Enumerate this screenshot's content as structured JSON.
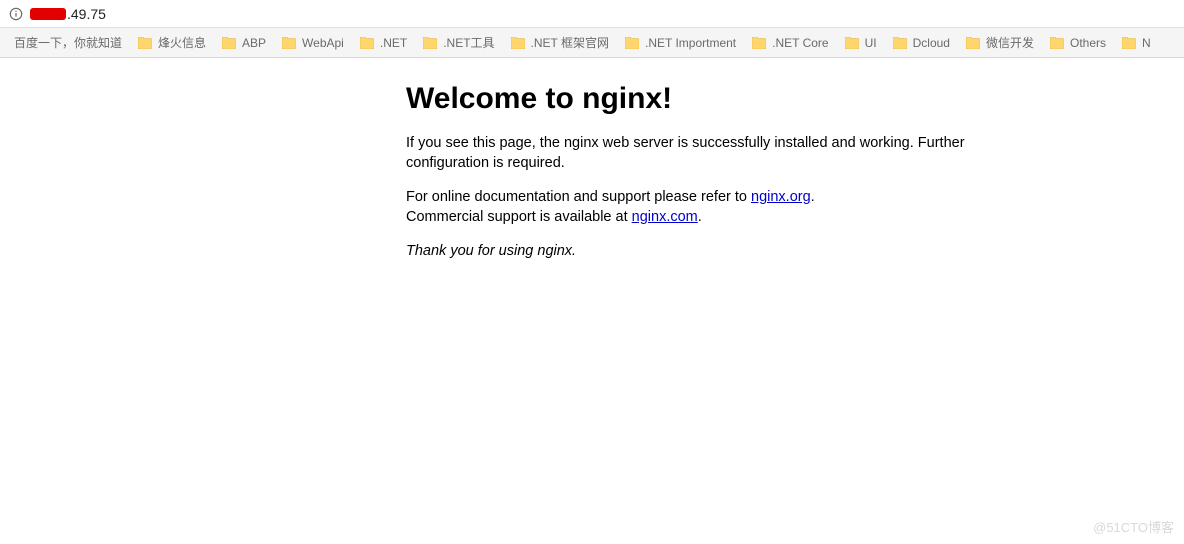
{
  "address": {
    "visible_ip_fragment": ".49.75"
  },
  "bookmarks": [
    {
      "type": "link",
      "label": "百度一下，你就知道",
      "name": "bm-baidu"
    },
    {
      "type": "folder",
      "label": "烽火信息",
      "name": "bm-fenghuo"
    },
    {
      "type": "folder",
      "label": "ABP",
      "name": "bm-abp"
    },
    {
      "type": "folder",
      "label": "WebApi",
      "name": "bm-webapi"
    },
    {
      "type": "folder",
      "label": ".NET",
      "name": "bm-dotnet"
    },
    {
      "type": "folder",
      "label": ".NET工具",
      "name": "bm-dotnet-tools"
    },
    {
      "type": "folder",
      "label": ".NET 框架官网",
      "name": "bm-dotnet-framework"
    },
    {
      "type": "folder",
      "label": ".NET Importment",
      "name": "bm-dotnet-importment"
    },
    {
      "type": "folder",
      "label": ".NET Core",
      "name": "bm-dotnet-core"
    },
    {
      "type": "folder",
      "label": "UI",
      "name": "bm-ui"
    },
    {
      "type": "folder",
      "label": "Dcloud",
      "name": "bm-dcloud"
    },
    {
      "type": "folder",
      "label": "微信开发",
      "name": "bm-wechat-dev"
    },
    {
      "type": "folder",
      "label": "Others",
      "name": "bm-others"
    },
    {
      "type": "folder",
      "label": "N",
      "name": "bm-n-partial"
    }
  ],
  "page": {
    "heading": "Welcome to nginx!",
    "p1": "If you see this page, the nginx web server is successfully installed and working. Further configuration is required.",
    "p2_pre": "For online documentation and support please refer to ",
    "p2_link1_text": "nginx.org",
    "p2_mid": ".",
    "p2_break": true,
    "p2_after": "Commercial support is available at ",
    "p2_link2_text": "nginx.com",
    "p2_end": ".",
    "thanks": "Thank you for using nginx."
  },
  "watermark": "@51CTO博客"
}
